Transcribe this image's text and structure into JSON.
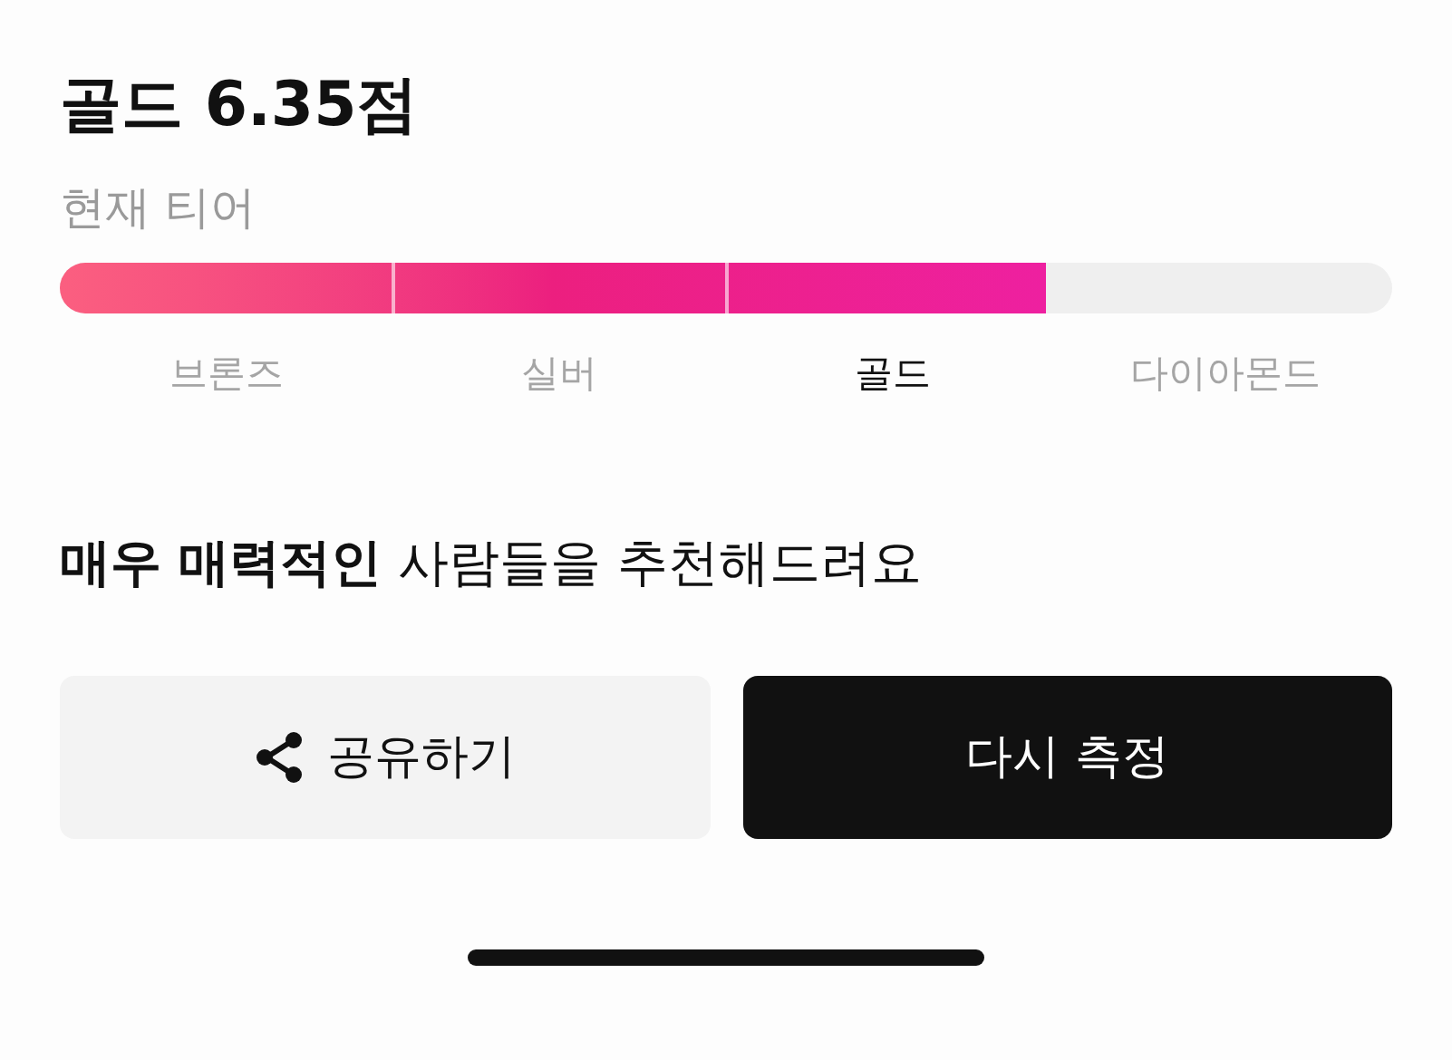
{
  "title": "골드 6.35점",
  "subtitle": "현재 티어",
  "tier_bar": {
    "level": 0.74
  },
  "tiers": [
    {
      "label": "브론즈",
      "selected": false
    },
    {
      "label": "실버",
      "selected": false
    },
    {
      "label": "골드",
      "selected": true
    },
    {
      "label": "다이아몬드",
      "selected": false
    }
  ],
  "headline": "**매우 매력적인** 사람들을 추천해드려요",
  "buttons": [
    {
      "kind": "share",
      "label": "공유하기"
    },
    {
      "kind": "primary",
      "label": "다시 측정"
    }
  ]
}
